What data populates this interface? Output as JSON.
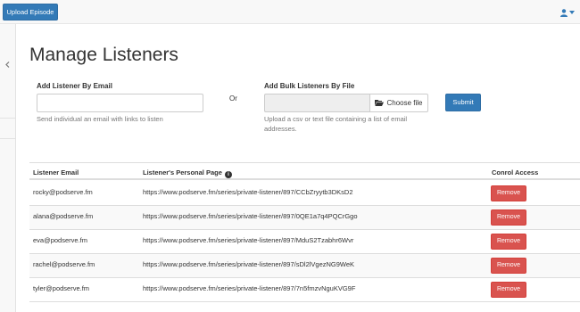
{
  "toolbar": {
    "upload_label": "Upload Episode"
  },
  "page": {
    "title": "Manage Listeners"
  },
  "add_email": {
    "label": "Add Listener By Email",
    "placeholder": "",
    "help": "Send individual an email with links to listen"
  },
  "or_label": "Or",
  "add_bulk": {
    "label": "Add Bulk Listeners By File",
    "choose_file_label": "Choose file",
    "help_line1": "Upload a csv or text file containing a list of email",
    "help_line2": "addresses."
  },
  "submit_label": "Submit",
  "table": {
    "headers": {
      "email": "Listener Email",
      "page": "Listener's Personal Page",
      "access": "Conrol Access"
    },
    "remove_label": "Remove",
    "rows": [
      {
        "email": "rocky@podserve.fm",
        "url": "https://www.podserve.fm/series/private-listener/897/CCbZryytb3DKsD2"
      },
      {
        "email": "alana@podserve.fm",
        "url": "https://www.podserve.fm/series/private-listener/897/0QE1a7q4PQCrGgo"
      },
      {
        "email": "eva@podserve.fm",
        "url": "https://www.podserve.fm/series/private-listener/897/MduS2Tzabhr6Wvr"
      },
      {
        "email": "rachel@podserve.fm",
        "url": "https://www.podserve.fm/series/private-listener/897/sDl2lVgezNG9WeK"
      },
      {
        "email": "tyler@podserve.fm",
        "url": "https://www.podserve.fm/series/private-listener/897/7n5fmzvNguKVG9F"
      }
    ]
  },
  "colors": {
    "primary": "#337ab7",
    "danger": "#d9534f"
  },
  "icons": {
    "user": "user-icon",
    "caret": "caret-down-icon",
    "sidebar_toggle": "chevron-left-icon",
    "folder": "folder-open-icon",
    "info": "info-circle-icon"
  }
}
